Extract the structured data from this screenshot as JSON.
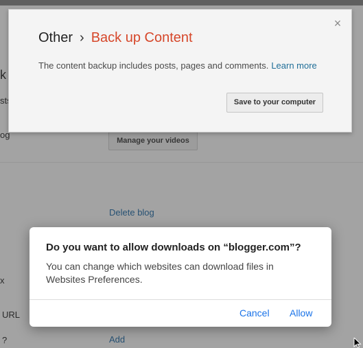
{
  "background": {
    "left_labels": [
      "k",
      "sts",
      "og",
      "x",
      "URL",
      "?"
    ],
    "manage_videos_button": "Manage your videos",
    "delete_blog_link": "Delete blog",
    "add_link": "Add"
  },
  "backup_dialog": {
    "breadcrumb_parent": "Other",
    "separator": "›",
    "title": "Back up Content",
    "description": "The content backup includes posts, pages and comments.",
    "learn_more": "Learn more",
    "save_button": "Save to your computer",
    "close_symbol": "×"
  },
  "permission_dialog": {
    "title": "Do you want to allow downloads on “blogger.com”?",
    "body": "You can change which websites can download files in Websites Preferences.",
    "cancel_label": "Cancel",
    "allow_label": "Allow"
  },
  "colors": {
    "accent_title": "#d6472a",
    "link": "#1f6e98",
    "system_button": "#1a73e8"
  },
  "icons": {
    "close": "close-icon",
    "cursor": "mouse-cursor-icon"
  }
}
